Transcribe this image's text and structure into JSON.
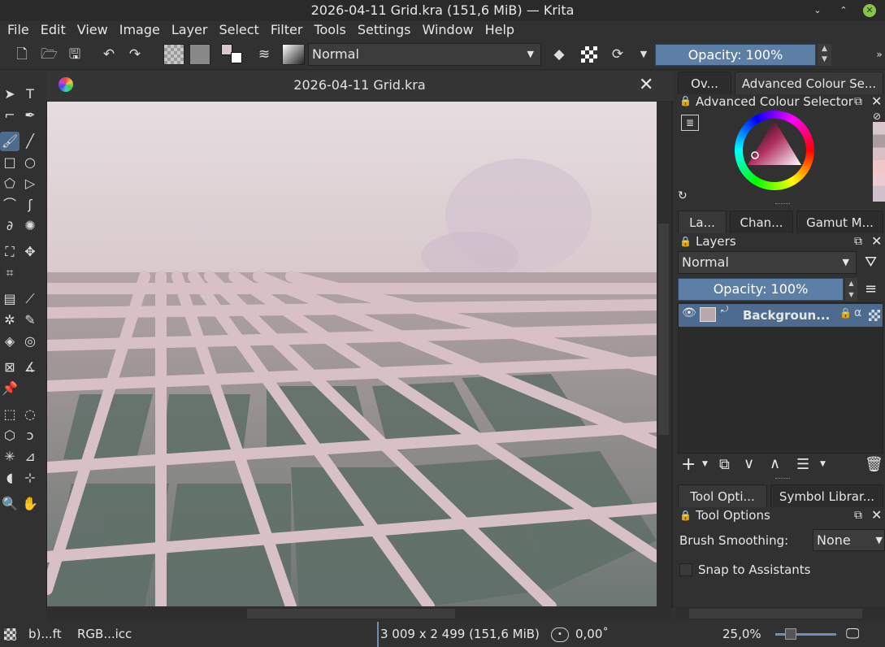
{
  "window": {
    "title": "2026-04-11 Grid.kra (151,6 MiB)  — Krita"
  },
  "menu": [
    "File",
    "Edit",
    "View",
    "Image",
    "Layer",
    "Select",
    "Filter",
    "Tools",
    "Settings",
    "Window",
    "Help"
  ],
  "toolbar": {
    "blend_mode": "Normal",
    "opacity_label": "Opacity: 100%"
  },
  "document": {
    "title": "2026-04-11 Grid.kra"
  },
  "right": {
    "top_tabs": [
      "Ov...",
      "Advanced Colour Se..."
    ],
    "colour_selector_title": "Advanced Colour Selector",
    "layer_tabs": [
      "La...",
      "Chan...",
      "Gamut M..."
    ],
    "layers_title": "Layers",
    "layers_blend": "Normal",
    "layers_opacity": "Opacity:  100%",
    "layer_name": "Backgroun...",
    "bottom_tabs": [
      "Tool Opti...",
      "Symbol Librar..."
    ],
    "tool_options_title": "Tool Options",
    "brush_smoothing_label": "Brush Smoothing:",
    "brush_smoothing_value": "None",
    "snap_label": "Snap to Assistants"
  },
  "status": {
    "profile_short": "b)...ft",
    "colorspace": "RGB...icc",
    "dimensions": "3 009 x 2 499 (151,6 MiB)",
    "rotation": "0,00˚",
    "zoom": "25,0%"
  },
  "colors": {
    "accent": "#5d7fa6",
    "panel": "#313131",
    "canvas_bg": "#d6c6c8"
  }
}
